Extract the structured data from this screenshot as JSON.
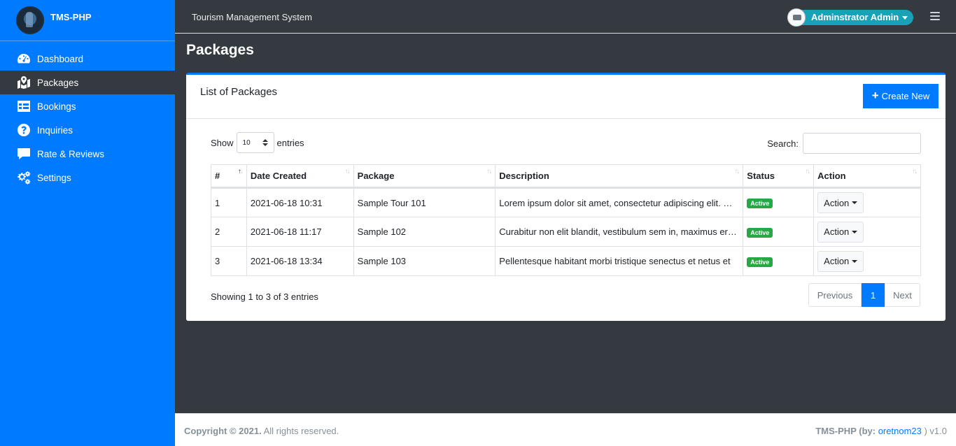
{
  "brand": {
    "name": "TMS-PHP"
  },
  "sidebar": {
    "items": [
      {
        "label": "Dashboard",
        "icon": "tachometer-icon"
      },
      {
        "label": "Packages",
        "icon": "map-icon",
        "active": true
      },
      {
        "label": "Bookings",
        "icon": "table-icon"
      },
      {
        "label": "Inquiries",
        "icon": "question-circle-icon"
      },
      {
        "label": "Rate & Reviews",
        "icon": "comment-icon"
      },
      {
        "label": "Settings",
        "icon": "cogs-icon"
      }
    ]
  },
  "header": {
    "system_title": "Tourism Management System",
    "user_name": "Adminstrator Admin"
  },
  "page": {
    "title": "Packages"
  },
  "card": {
    "title": "List of Packages",
    "create_label": "Create New"
  },
  "table_controls": {
    "show_label": "Show",
    "entries_value": "10",
    "entries_label": "entries",
    "search_label": "Search:",
    "search_value": ""
  },
  "table": {
    "columns": [
      "#",
      "Date Created",
      "Package",
      "Description",
      "Status",
      "Action"
    ],
    "rows": [
      {
        "num": "1",
        "date": "2021-06-18 10:31",
        "package": "Sample Tour 101",
        "description": "Lorem ipsum dolor sit amet, consectetur adipiscing elit. Morbi",
        "status": "Active",
        "action": "Action"
      },
      {
        "num": "2",
        "date": "2021-06-18 11:17",
        "package": "Sample 102",
        "description": "Curabitur non elit blandit, vestibulum sem in, maximus eros.",
        "status": "Active",
        "action": "Action"
      },
      {
        "num": "3",
        "date": "2021-06-18 13:34",
        "package": "Sample 103",
        "description": "Pellentesque habitant morbi tristique senectus et netus et",
        "status": "Active",
        "action": "Action"
      }
    ]
  },
  "pagination": {
    "info": "Showing 1 to 3 of 3 entries",
    "previous": "Previous",
    "current": "1",
    "next": "Next"
  },
  "footer": {
    "copyright": "Copyright © 2021.",
    "rights": "All rights reserved.",
    "app": "TMS-PHP (by:",
    "author": "oretnom23",
    "version": ") v1.0"
  },
  "colors": {
    "primary": "#007bff",
    "dark": "#343a40",
    "success": "#28a745",
    "info": "#17a2b8"
  }
}
